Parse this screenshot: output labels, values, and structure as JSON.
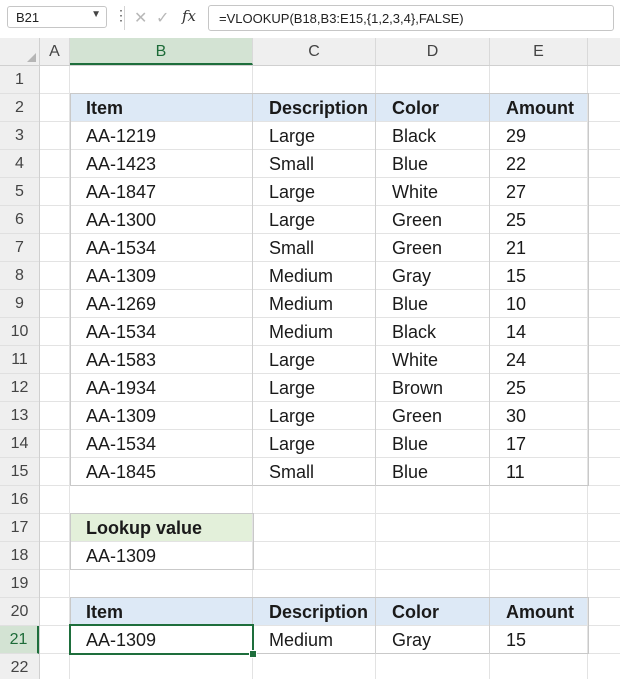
{
  "formula_bar": {
    "name_box": "B21",
    "formula": "=VLOOKUP(B18,B3:E15,{1,2,3,4},FALSE)"
  },
  "icons": {
    "name_box_chevron": "chevron-down-icon",
    "more": "vertical-dots-icon",
    "cancel": "cancel-x-icon",
    "enter": "checkmark-icon",
    "function": "fx-icon"
  },
  "columns": [
    "A",
    "B",
    "C",
    "D",
    "E"
  ],
  "rows": [
    "1",
    "2",
    "3",
    "4",
    "5",
    "6",
    "7",
    "8",
    "9",
    "10",
    "11",
    "12",
    "13",
    "14",
    "15",
    "16",
    "17",
    "18",
    "19",
    "20",
    "21",
    "22"
  ],
  "table": {
    "headers": [
      "Item",
      "Description",
      "Color",
      "Amount"
    ],
    "rows": [
      [
        "AA-1219",
        "Large",
        "Black",
        "29"
      ],
      [
        "AA-1423",
        "Small",
        "Blue",
        "22"
      ],
      [
        "AA-1847",
        "Large",
        "White",
        "27"
      ],
      [
        "AA-1300",
        "Large",
        "Green",
        "25"
      ],
      [
        "AA-1534",
        "Small",
        "Green",
        "21"
      ],
      [
        "AA-1309",
        "Medium",
        "Gray",
        "15"
      ],
      [
        "AA-1269",
        "Medium",
        "Blue",
        "10"
      ],
      [
        "AA-1534",
        "Medium",
        "Black",
        "14"
      ],
      [
        "AA-1583",
        "Large",
        "White",
        "24"
      ],
      [
        "AA-1934",
        "Large",
        "Brown",
        "25"
      ],
      [
        "AA-1309",
        "Large",
        "Green",
        "30"
      ],
      [
        "AA-1534",
        "Large",
        "Blue",
        "17"
      ],
      [
        "AA-1845",
        "Small",
        "Blue",
        "11"
      ]
    ]
  },
  "lookup": {
    "label": "Lookup value",
    "value": "AA-1309"
  },
  "result": {
    "headers": [
      "Item",
      "Description",
      "Color",
      "Amount"
    ],
    "values": [
      "AA-1309",
      "Medium",
      "Gray",
      "15"
    ]
  },
  "colors": {
    "header_fill": "#dde9f6",
    "lookup_header_fill": "#e3f0da",
    "selection": "#1e6e3c"
  }
}
